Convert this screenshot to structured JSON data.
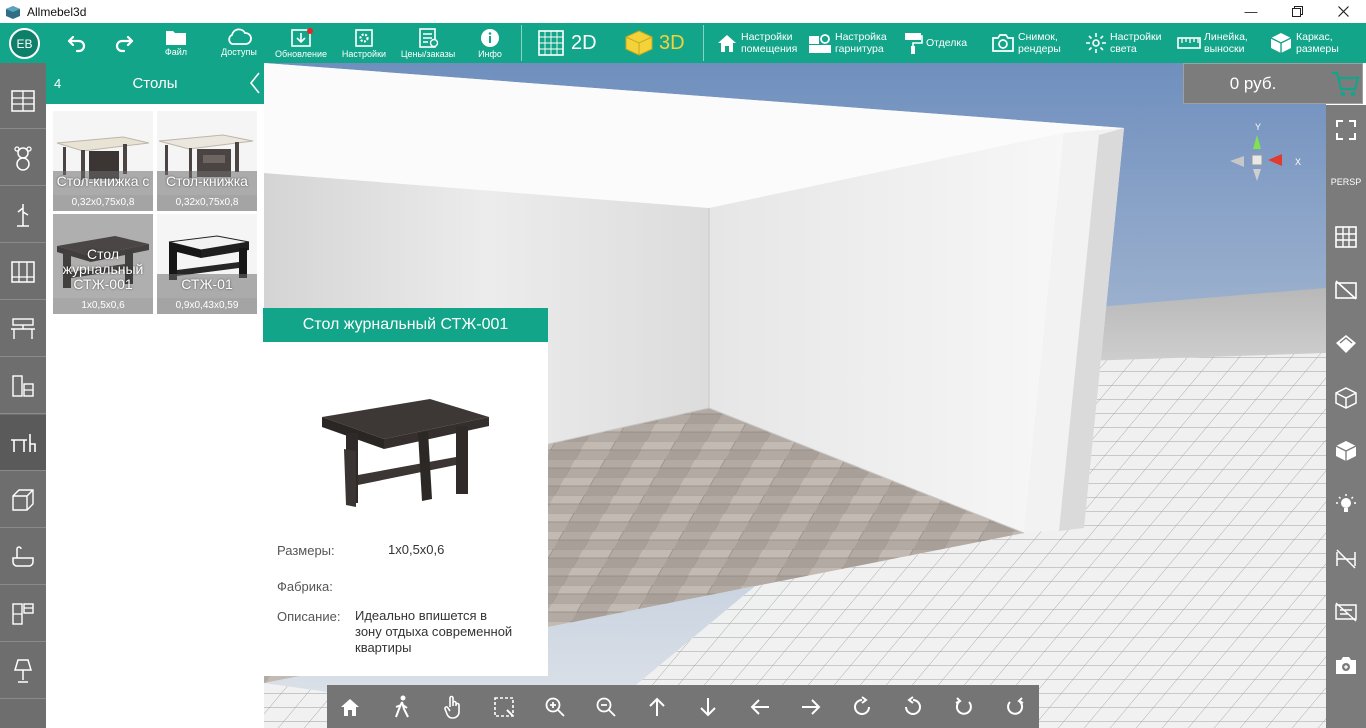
{
  "window": {
    "title": "Allmebel3d",
    "controls": [
      "minimize",
      "restore",
      "close"
    ]
  },
  "user": {
    "initials": "ЕВ"
  },
  "toolbar": {
    "undo_icon": "undo-icon",
    "redo_icon": "redo-icon",
    "items": [
      {
        "label": "Файл",
        "icon": "folder-icon"
      },
      {
        "label": "Доступы",
        "icon": "cloud-icon"
      },
      {
        "label": "Обновление",
        "icon": "download-icon"
      },
      {
        "label": "Настройки",
        "icon": "settings-icon"
      },
      {
        "label": "Цены/заказы",
        "icon": "prices-icon"
      },
      {
        "label": "Инфо",
        "icon": "info-icon"
      }
    ],
    "view2d": "2D",
    "view3d": "3D",
    "right_items": [
      {
        "label_line1": "Настройки",
        "label_line2": "помещения",
        "icon": "house-icon"
      },
      {
        "label_line1": "Настройка",
        "label_line2": "гарнитура",
        "icon": "kitchen-set-icon"
      },
      {
        "label_line1": "Отделка",
        "label_line2": "",
        "icon": "paint-roller-icon"
      },
      {
        "label_line1": "Снимок,",
        "label_line2": "рендеры",
        "icon": "camera-icon"
      },
      {
        "label_line1": "Настройки",
        "label_line2": "света",
        "icon": "light-icon"
      },
      {
        "label_line1": "Линейка,",
        "label_line2": "выноски",
        "icon": "ruler-icon"
      },
      {
        "label_line1": "Каркас,",
        "label_line2": "размеры",
        "icon": "frame-box-icon"
      }
    ]
  },
  "price": {
    "value": "0 руб."
  },
  "catalog": {
    "count": "4",
    "title": "Столы",
    "items": [
      {
        "name": "Стол-книжка с",
        "size": "0,32х0,75х0,8"
      },
      {
        "name": "Стол-книжка",
        "size": "0,32х0,75х0,8"
      },
      {
        "name": "Стол журнальный СТЖ-001",
        "size": "1х0,5х0,6"
      },
      {
        "name": "СТЖ-01",
        "size": "0,9х0,43х0,59"
      }
    ]
  },
  "detail": {
    "title": "Стол журнальный СТЖ-001",
    "size_label": "Размеры:",
    "size_value": "1х0,5х0,6",
    "factory_label": "Фабрика:",
    "factory_value": "",
    "desc_label": "Описание:",
    "desc_value": "Идеально впишется в зону отдыха современной квартиры"
  },
  "gizmo": {
    "y_label": "Y",
    "x_label": "X"
  },
  "right_sidebar": {
    "persp_label": "PERSP"
  },
  "colors": {
    "accent": "#13a589",
    "sidebar": "#6e6e6e",
    "toolbar_yellow": "#f3d23a"
  }
}
